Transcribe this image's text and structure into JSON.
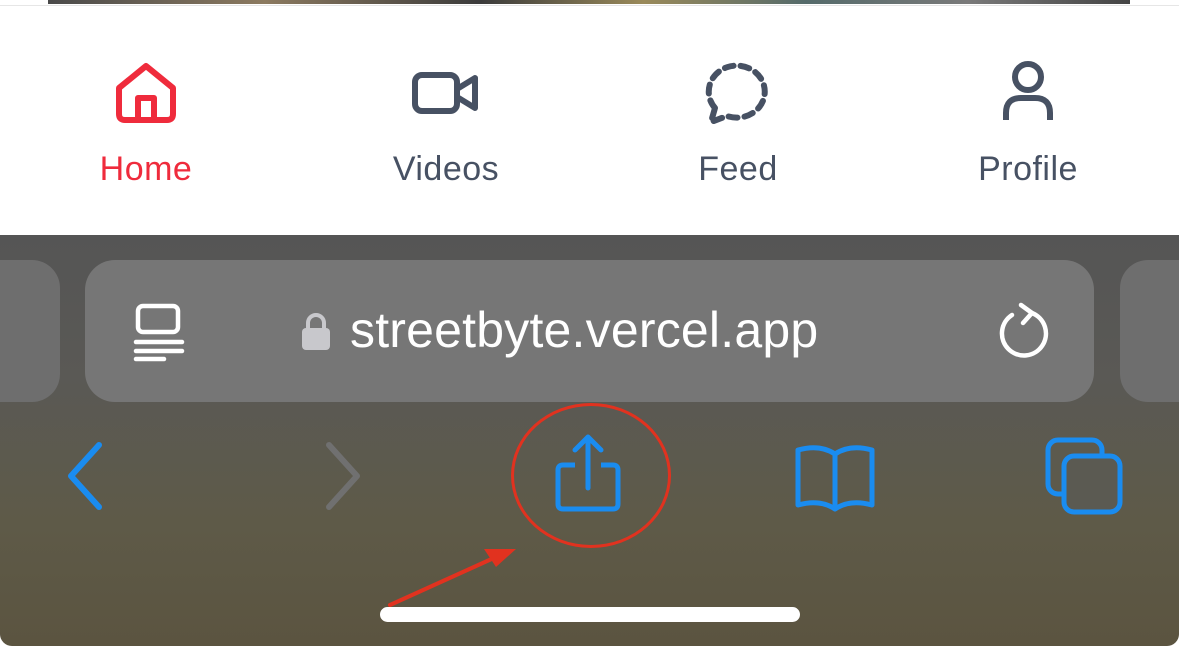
{
  "tabbar": {
    "items": [
      {
        "label": "Home",
        "icon": "home-icon",
        "active": true
      },
      {
        "label": "Videos",
        "icon": "video-camera-icon",
        "active": false
      },
      {
        "label": "Feed",
        "icon": "chat-bubble-dashed-icon",
        "active": false
      },
      {
        "label": "Profile",
        "icon": "user-icon",
        "active": false
      }
    ],
    "active_color": "#ef2b3c",
    "inactive_color": "#475163"
  },
  "browser": {
    "url": "streetbyte.vercel.app",
    "icons": {
      "reader": "reader-mode-icon",
      "lock": "lock-icon",
      "reload": "reload-icon",
      "back": "back-chevron-icon",
      "forward": "forward-chevron-icon",
      "share": "share-icon",
      "bookmarks": "bookmarks-book-icon",
      "tabs": "tabs-icon"
    },
    "accent_color": "#1a8cf0",
    "annotation_color": "#e1321f"
  }
}
